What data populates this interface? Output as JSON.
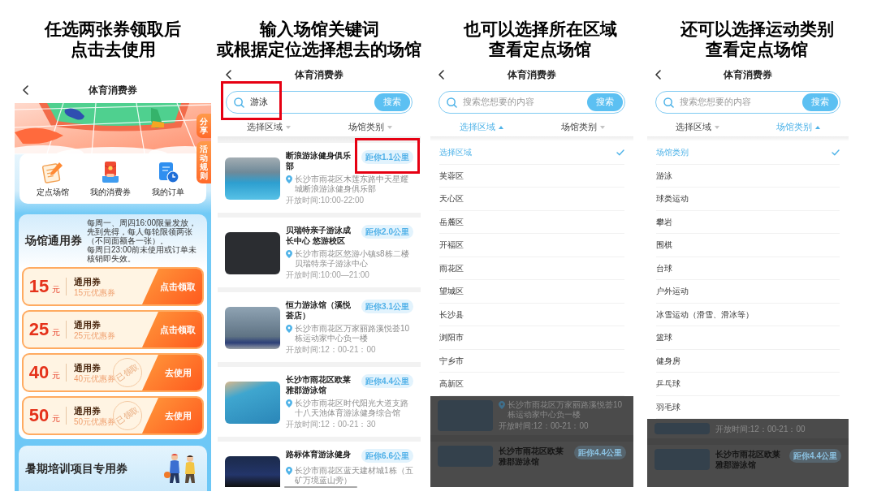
{
  "panels": [
    {
      "kind": "coupons",
      "caption": [
        "任选两张券领取后",
        "点击去使用"
      ],
      "screen": {
        "title": "体育消费券",
        "side_tabs": [
          "分享",
          "活动规则"
        ],
        "shortcuts": [
          "定点场馆",
          "我的消费券",
          "我的订单"
        ],
        "coupon_section": {
          "title": "场馆通用券",
          "notes": [
            "每周一、周四16:00限量发放，先到先得，每人每轮限领两张（不同面额各一张）。",
            "每周日23:00前未使用或订单未核销即失效。"
          ],
          "coupons": [
            {
              "amount": "15",
              "unit": "元",
              "name": "通用券",
              "subtitle": "15元优惠券",
              "action": "点击领取"
            },
            {
              "amount": "25",
              "unit": "元",
              "name": "通用券",
              "subtitle": "25元优惠券",
              "action": "点击领取"
            },
            {
              "amount": "40",
              "unit": "元",
              "name": "通用券",
              "subtitle": "40元优惠券",
              "action": "去使用",
              "stamp": "已领取"
            },
            {
              "amount": "50",
              "unit": "元",
              "name": "通用券",
              "subtitle": "50元优惠券",
              "action": "去使用",
              "stamp": "已领取"
            }
          ]
        },
        "next_section": {
          "title": "暑期培训项目专用券"
        }
      }
    },
    {
      "kind": "venue_search",
      "caption": [
        "输入场馆关键词",
        "或根据定位选择想去的场馆"
      ],
      "screen": {
        "title": "体育消费券",
        "search": {
          "value": "游泳",
          "button": "搜索",
          "highlighted": true
        },
        "filters": [
          {
            "label": "选择区域",
            "expanded": false
          },
          {
            "label": "场馆类别",
            "expanded": false
          }
        ],
        "venues": [
          {
            "name": "断浪游泳健身俱乐部",
            "distance": "距你1.1公里",
            "highlighted": true,
            "address": "长沙市雨花区木莲东路中天星耀城断浪游泳健身俱乐部",
            "hours": "开放时间:10:00-22:00"
          },
          {
            "name": "贝瑞特亲子游泳成长中心 悠游校区",
            "distance": "距你2.0公里",
            "highlighted": false,
            "address": "长沙市雨花区悠游小镇s8栋二楼贝瑞特亲子游泳中心",
            "hours": "开放时间:10:00—21:00"
          },
          {
            "name": "恒力游泳馆（溪悦荟店）",
            "distance": "距你3.1公里",
            "highlighted": false,
            "address": "长沙市雨花区万家丽路溪悦荟10栋运动家中心负一楼",
            "hours": "开放时间:12：00-21：00"
          },
          {
            "name": "长沙市雨花区欧莱雅郡游泳馆",
            "distance": "距你4.4公里",
            "highlighted": false,
            "address": "长沙市雨花区时代阳光大道支路十八天池体育游泳健身综合馆",
            "hours": "开放时间:12：00-21：30"
          },
          {
            "name": "路标体育游泳健身",
            "distance": "距你6.6公里",
            "highlighted": false,
            "address": "长沙市雨花区蓝天建材城1栋（五矿万境蓝山旁）"
          }
        ]
      }
    },
    {
      "kind": "filter_menu",
      "caption": [
        "也可以选择所在区域",
        "查看定点场馆"
      ],
      "screen": {
        "title": "体育消费券",
        "search": {
          "placeholder": "搜索您想要的内容",
          "button": "搜索",
          "highlighted": false
        },
        "filters": [
          {
            "label": "选择区域",
            "expanded": true
          },
          {
            "label": "场馆类别",
            "expanded": false
          }
        ],
        "options": [
          {
            "label": "选择区域",
            "selected": true
          },
          {
            "label": "芙蓉区",
            "selected": false
          },
          {
            "label": "天心区",
            "selected": false
          },
          {
            "label": "岳麓区",
            "selected": false
          },
          {
            "label": "开福区",
            "selected": false
          },
          {
            "label": "雨花区",
            "selected": false
          },
          {
            "label": "望城区",
            "selected": false
          },
          {
            "label": "长沙县",
            "selected": false
          },
          {
            "label": "浏阳市",
            "selected": false
          },
          {
            "label": "宁乡市",
            "selected": false
          },
          {
            "label": "高新区",
            "selected": false
          }
        ],
        "dimmed_list": [
          {
            "address": "长沙市雨花区万家丽路溪悦荟10栋运动家中心负一楼",
            "hours": "开放时间:12：00-21：00"
          },
          {
            "name": "长沙市雨花区欧莱雅郡游泳馆",
            "distance": "距你4.4公里"
          }
        ]
      }
    },
    {
      "kind": "filter_menu",
      "caption": [
        "还可以选择运动类别",
        "查看定点场馆"
      ],
      "screen": {
        "title": "体育消费券",
        "search": {
          "placeholder": "搜索您想要的内容",
          "button": "搜索",
          "highlighted": false
        },
        "filters": [
          {
            "label": "选择区域",
            "expanded": false
          },
          {
            "label": "场馆类别",
            "expanded": true
          }
        ],
        "options": [
          {
            "label": "场馆类别",
            "selected": true
          },
          {
            "label": "游泳",
            "selected": false
          },
          {
            "label": "球类运动",
            "selected": false
          },
          {
            "label": "攀岩",
            "selected": false
          },
          {
            "label": "围棋",
            "selected": false
          },
          {
            "label": "台球",
            "selected": false
          },
          {
            "label": "户外运动",
            "selected": false
          },
          {
            "label": "冰雪运动（滑雪、滑冰等）",
            "selected": false
          },
          {
            "label": "篮球",
            "selected": false
          },
          {
            "label": "健身房",
            "selected": false
          },
          {
            "label": "乒乓球",
            "selected": false
          },
          {
            "label": "羽毛球",
            "selected": false
          }
        ],
        "dimmed_list": [
          {
            "hours": "开放时间:12：00-21：00"
          },
          {
            "name": "长沙市雨花区欧莱雅郡游泳馆",
            "distance": "距你4.4公里"
          }
        ]
      }
    }
  ]
}
